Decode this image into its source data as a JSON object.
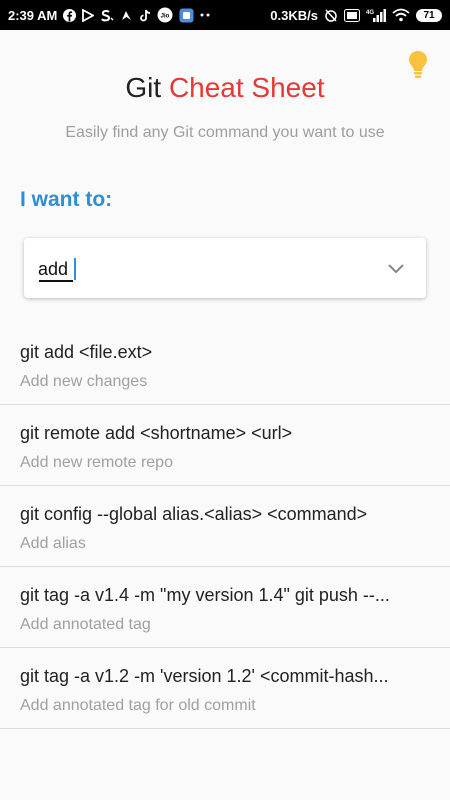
{
  "status_bar": {
    "time": "2:39 AM",
    "net_speed": "0.3KB/s",
    "network_label": "4G",
    "battery": "71"
  },
  "header": {
    "title_prefix": "Git",
    "title_accent": "Cheat Sheet",
    "subtitle": "Easily find any Git command you want to use",
    "accent_color": "#e53935",
    "bulb_icon": "lightbulb-icon"
  },
  "prompt_label": "I want to:",
  "select": {
    "value": "add",
    "chevron_icon": "chevron-down-icon"
  },
  "commands": [
    {
      "command": "git add <file.ext>",
      "description": "Add new changes"
    },
    {
      "command": "git remote add <shortname> <url>",
      "description": "Add new remote repo"
    },
    {
      "command": "git config --global alias.<alias> <command>",
      "description": "Add alias"
    },
    {
      "command": "git tag -a v1.4 -m \"my version 1.4\"  git push --...",
      "description": "Add annotated tag"
    },
    {
      "command": "git tag -a v1.2 -m 'version 1.2' <commit-hash...",
      "description": "Add annotated tag for old commit"
    }
  ],
  "colors": {
    "prompt_blue": "#2d8fd5",
    "bulb_yellow": "#f9c23c"
  }
}
